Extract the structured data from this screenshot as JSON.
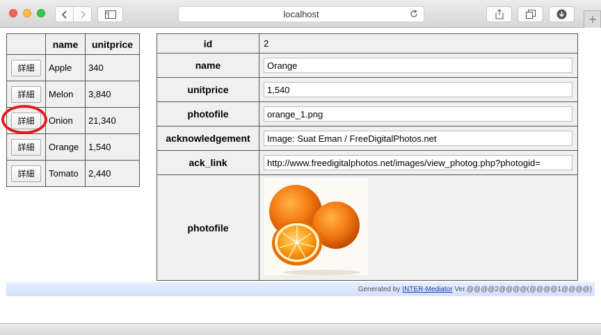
{
  "browser": {
    "address": "localhost",
    "icons": {
      "back": "chevron-left-icon",
      "forward": "chevron-right-icon",
      "sidebar": "sidebar-icon",
      "reload": "reload-icon",
      "share": "share-icon",
      "tabs": "tabs-icon",
      "download": "download-icon",
      "new_tab": "plus-icon"
    }
  },
  "list": {
    "headers": [
      "",
      "name",
      "unitprice"
    ],
    "button_label": "詳細",
    "rows": [
      {
        "name": "Apple",
        "unitprice": "340"
      },
      {
        "name": "Melon",
        "unitprice": "3,840"
      },
      {
        "name": "Onion",
        "unitprice": "21,340"
      },
      {
        "name": "Orange",
        "unitprice": "1,540"
      },
      {
        "name": "Tomato",
        "unitprice": "2,440"
      }
    ]
  },
  "detail": {
    "id_label": "id",
    "id_value": "2",
    "name_label": "name",
    "name_value": "Orange",
    "unitprice_label": "unitprice",
    "unitprice_value": "1,540",
    "photofile_label": "photofile",
    "photofile_value": "orange_1.png",
    "ack_label": "acknowledgement",
    "ack_value": "Image: Suat Eman / FreeDigitalPhotos.net",
    "ack_link_label": "ack_link",
    "ack_link_value": "http://www.freedigitalphotos.net/images/view_photog.php?photogid=",
    "photo_label": "photofile"
  },
  "footer": {
    "prefix": "Generated by",
    "link": "INTER-Mediator",
    "suffix": "Ver.@@@@2@@@@(@@@@1@@@@)"
  },
  "colors": {
    "highlight_circle": "#e31d1d",
    "footer_bg": "#dce6ff",
    "cell_bg": "#f0f0f0"
  }
}
